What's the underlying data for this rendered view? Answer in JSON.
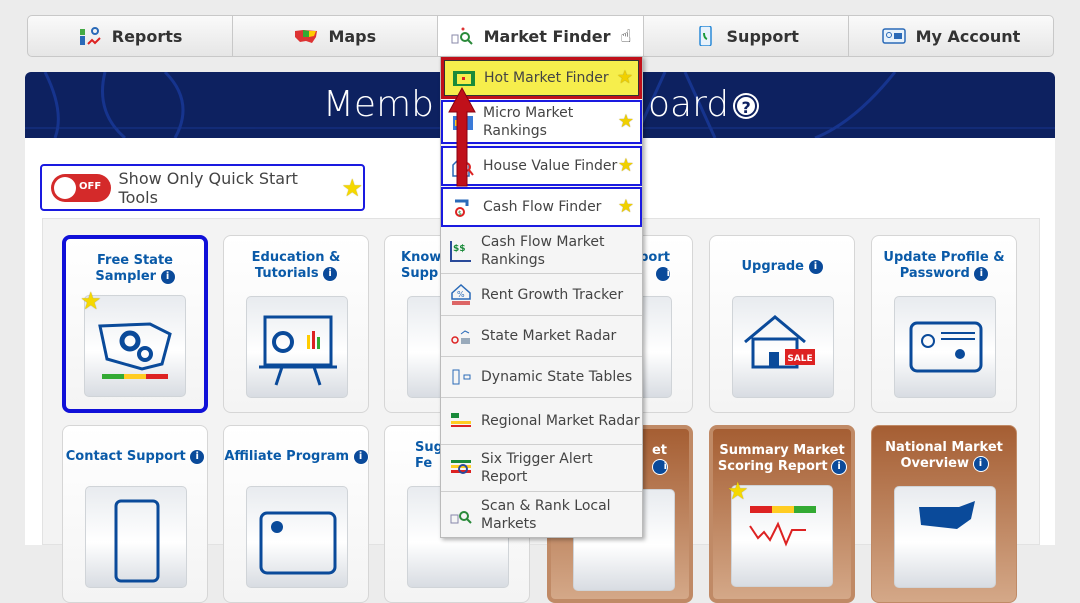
{
  "nav": {
    "tabs": [
      {
        "label": "Reports",
        "icon": "reports-chart-icon"
      },
      {
        "label": "Maps",
        "icon": "us-map-icon"
      },
      {
        "label": "Market Finder",
        "icon": "market-finder-icon",
        "active": true
      },
      {
        "label": "Support",
        "icon": "phone-icon"
      },
      {
        "label": "My Account",
        "icon": "account-card-icon"
      }
    ]
  },
  "banner": {
    "title_left": "Memb",
    "title_right": "oard",
    "help_icon": "question-icon"
  },
  "toggle": {
    "state": "OFF",
    "label": "Show Only Quick Start Tools",
    "icon": "star-icon"
  },
  "cards": {
    "row1": [
      {
        "title1": "Free State",
        "title2": "Sampler",
        "quick": true,
        "selected": true
      },
      {
        "title1": "Education &",
        "title2": "Tutorials"
      },
      {
        "title1": "Know",
        "title2": "Supp"
      },
      {
        "title1": "port",
        "title2": ""
      },
      {
        "title1": "Upgrade",
        "title2": ""
      },
      {
        "title1": "Update Profile &",
        "title2": "Password"
      }
    ],
    "row2": [
      {
        "title1": "Contact Support",
        "title2": ""
      },
      {
        "title1": "Affiliate Program",
        "title2": ""
      },
      {
        "title1": "Sugg",
        "title2": "Fe"
      },
      {
        "title1": "et",
        "title2": ""
      },
      {
        "title1": "Summary Market",
        "title2": "Scoring Report",
        "quick": true,
        "selected": true
      },
      {
        "title1": "National Market",
        "title2": "Overview"
      }
    ],
    "sale_label": "SALE"
  },
  "menu": {
    "items": [
      {
        "label": "Hot Market Finder",
        "quick": true,
        "highlighted": true
      },
      {
        "label": "Micro Market Rankings",
        "quick": true
      },
      {
        "label": "House Value Finder",
        "quick": true
      },
      {
        "label": "Cash Flow Finder",
        "quick": true
      },
      {
        "label": "Cash Flow Market Rankings"
      },
      {
        "label": "Rent Growth Tracker"
      },
      {
        "label": "State Market Radar"
      },
      {
        "label": "Dynamic State Tables"
      },
      {
        "label": "Regional Market Radar"
      },
      {
        "label": "Six Trigger Alert Report"
      },
      {
        "label": "Scan & Rank Local Markets"
      }
    ]
  },
  "colors": {
    "banner": "#0d2160",
    "quick_border": "#1a1ae0",
    "highlight": "#f6ee4c",
    "highlight_border": "#c0101a",
    "toggle_off": "#d42a2a",
    "card_title": "#0a5aa8",
    "arrow": "#c0101a"
  }
}
